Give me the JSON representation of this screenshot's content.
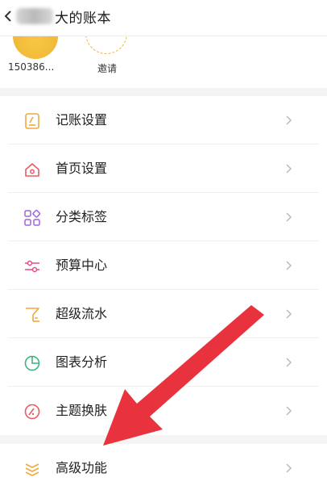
{
  "header": {
    "title": "大的账本"
  },
  "members": [
    {
      "name": "150386..."
    },
    {
      "name": "邀请"
    }
  ],
  "menu": [
    {
      "label": "记账设置",
      "icon": "edit-note-icon"
    },
    {
      "label": "首页设置",
      "icon": "home-icon"
    },
    {
      "label": "分类标签",
      "icon": "category-grid-icon"
    },
    {
      "label": "预算中心",
      "icon": "sliders-icon"
    },
    {
      "label": "超级流水",
      "icon": "flow-chart-icon"
    },
    {
      "label": "图表分析",
      "icon": "pie-chart-icon"
    },
    {
      "label": "主题换肤",
      "icon": "theme-palette-icon"
    },
    {
      "label": "高级功能",
      "icon": "layers-icon"
    }
  ],
  "colors": {
    "accent_orange": "#f0a93a",
    "arrow_red": "#e8333f",
    "icon_purple": "#a067d6",
    "icon_pink": "#e94a87",
    "icon_green": "#3cb580",
    "icon_red": "#e85b63"
  }
}
